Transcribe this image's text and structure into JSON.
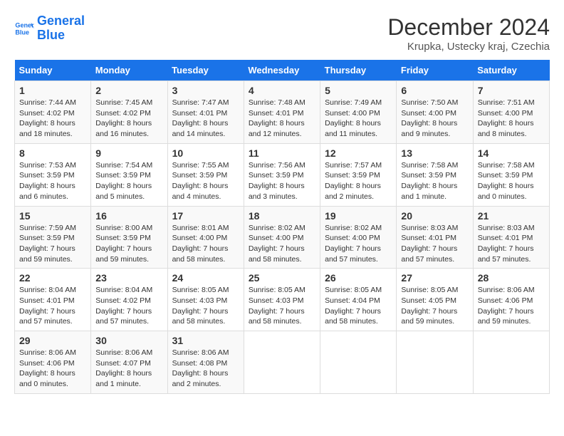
{
  "header": {
    "logo_line1": "General",
    "logo_line2": "Blue",
    "title": "December 2024",
    "subtitle": "Krupka, Ustecky kraj, Czechia"
  },
  "weekdays": [
    "Sunday",
    "Monday",
    "Tuesday",
    "Wednesday",
    "Thursday",
    "Friday",
    "Saturday"
  ],
  "weeks": [
    [
      {
        "day": "1",
        "text": "Sunrise: 7:44 AM\nSunset: 4:02 PM\nDaylight: 8 hours and 18 minutes."
      },
      {
        "day": "2",
        "text": "Sunrise: 7:45 AM\nSunset: 4:02 PM\nDaylight: 8 hours and 16 minutes."
      },
      {
        "day": "3",
        "text": "Sunrise: 7:47 AM\nSunset: 4:01 PM\nDaylight: 8 hours and 14 minutes."
      },
      {
        "day": "4",
        "text": "Sunrise: 7:48 AM\nSunset: 4:01 PM\nDaylight: 8 hours and 12 minutes."
      },
      {
        "day": "5",
        "text": "Sunrise: 7:49 AM\nSunset: 4:00 PM\nDaylight: 8 hours and 11 minutes."
      },
      {
        "day": "6",
        "text": "Sunrise: 7:50 AM\nSunset: 4:00 PM\nDaylight: 8 hours and 9 minutes."
      },
      {
        "day": "7",
        "text": "Sunrise: 7:51 AM\nSunset: 4:00 PM\nDaylight: 8 hours and 8 minutes."
      }
    ],
    [
      {
        "day": "8",
        "text": "Sunrise: 7:53 AM\nSunset: 3:59 PM\nDaylight: 8 hours and 6 minutes."
      },
      {
        "day": "9",
        "text": "Sunrise: 7:54 AM\nSunset: 3:59 PM\nDaylight: 8 hours and 5 minutes."
      },
      {
        "day": "10",
        "text": "Sunrise: 7:55 AM\nSunset: 3:59 PM\nDaylight: 8 hours and 4 minutes."
      },
      {
        "day": "11",
        "text": "Sunrise: 7:56 AM\nSunset: 3:59 PM\nDaylight: 8 hours and 3 minutes."
      },
      {
        "day": "12",
        "text": "Sunrise: 7:57 AM\nSunset: 3:59 PM\nDaylight: 8 hours and 2 minutes."
      },
      {
        "day": "13",
        "text": "Sunrise: 7:58 AM\nSunset: 3:59 PM\nDaylight: 8 hours and 1 minute."
      },
      {
        "day": "14",
        "text": "Sunrise: 7:58 AM\nSunset: 3:59 PM\nDaylight: 8 hours and 0 minutes."
      }
    ],
    [
      {
        "day": "15",
        "text": "Sunrise: 7:59 AM\nSunset: 3:59 PM\nDaylight: 7 hours and 59 minutes."
      },
      {
        "day": "16",
        "text": "Sunrise: 8:00 AM\nSunset: 3:59 PM\nDaylight: 7 hours and 59 minutes."
      },
      {
        "day": "17",
        "text": "Sunrise: 8:01 AM\nSunset: 4:00 PM\nDaylight: 7 hours and 58 minutes."
      },
      {
        "day": "18",
        "text": "Sunrise: 8:02 AM\nSunset: 4:00 PM\nDaylight: 7 hours and 58 minutes."
      },
      {
        "day": "19",
        "text": "Sunrise: 8:02 AM\nSunset: 4:00 PM\nDaylight: 7 hours and 57 minutes."
      },
      {
        "day": "20",
        "text": "Sunrise: 8:03 AM\nSunset: 4:01 PM\nDaylight: 7 hours and 57 minutes."
      },
      {
        "day": "21",
        "text": "Sunrise: 8:03 AM\nSunset: 4:01 PM\nDaylight: 7 hours and 57 minutes."
      }
    ],
    [
      {
        "day": "22",
        "text": "Sunrise: 8:04 AM\nSunset: 4:01 PM\nDaylight: 7 hours and 57 minutes."
      },
      {
        "day": "23",
        "text": "Sunrise: 8:04 AM\nSunset: 4:02 PM\nDaylight: 7 hours and 57 minutes."
      },
      {
        "day": "24",
        "text": "Sunrise: 8:05 AM\nSunset: 4:03 PM\nDaylight: 7 hours and 58 minutes."
      },
      {
        "day": "25",
        "text": "Sunrise: 8:05 AM\nSunset: 4:03 PM\nDaylight: 7 hours and 58 minutes."
      },
      {
        "day": "26",
        "text": "Sunrise: 8:05 AM\nSunset: 4:04 PM\nDaylight: 7 hours and 58 minutes."
      },
      {
        "day": "27",
        "text": "Sunrise: 8:05 AM\nSunset: 4:05 PM\nDaylight: 7 hours and 59 minutes."
      },
      {
        "day": "28",
        "text": "Sunrise: 8:06 AM\nSunset: 4:06 PM\nDaylight: 7 hours and 59 minutes."
      }
    ],
    [
      {
        "day": "29",
        "text": "Sunrise: 8:06 AM\nSunset: 4:06 PM\nDaylight: 8 hours and 0 minutes."
      },
      {
        "day": "30",
        "text": "Sunrise: 8:06 AM\nSunset: 4:07 PM\nDaylight: 8 hours and 1 minute."
      },
      {
        "day": "31",
        "text": "Sunrise: 8:06 AM\nSunset: 4:08 PM\nDaylight: 8 hours and 2 minutes."
      },
      null,
      null,
      null,
      null
    ]
  ]
}
